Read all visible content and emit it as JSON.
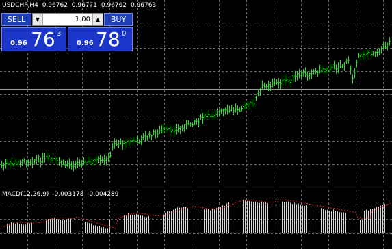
{
  "header": {
    "symbol_tf": "USDCHF,H4",
    "ohlc": [
      "0.96762",
      "0.96771",
      "0.96762",
      "0.96763"
    ]
  },
  "trade_panel": {
    "sell_label": "SELL",
    "buy_label": "BUY",
    "lot_value": "1.00",
    "lot_down_glyph": "▼",
    "lot_up_glyph": "▲",
    "sell_price": {
      "prefix": "0.96",
      "big": "76",
      "sup": "3"
    },
    "buy_price": {
      "prefix": "0.96",
      "big": "78",
      "sup": "0"
    }
  },
  "indicator": {
    "name": "MACD(12,26,9)",
    "values": [
      "-0.003178",
      "-0.004289"
    ]
  },
  "colors": {
    "background": "#000000",
    "grid": "#6b6b6b",
    "bars": "#22e022",
    "macd_histogram": "#d8d8d8",
    "macd_signal": "#e02020",
    "button": "#1f3fb5",
    "button_border": "#6f86e6",
    "separator": "#a0a0a0"
  }
}
